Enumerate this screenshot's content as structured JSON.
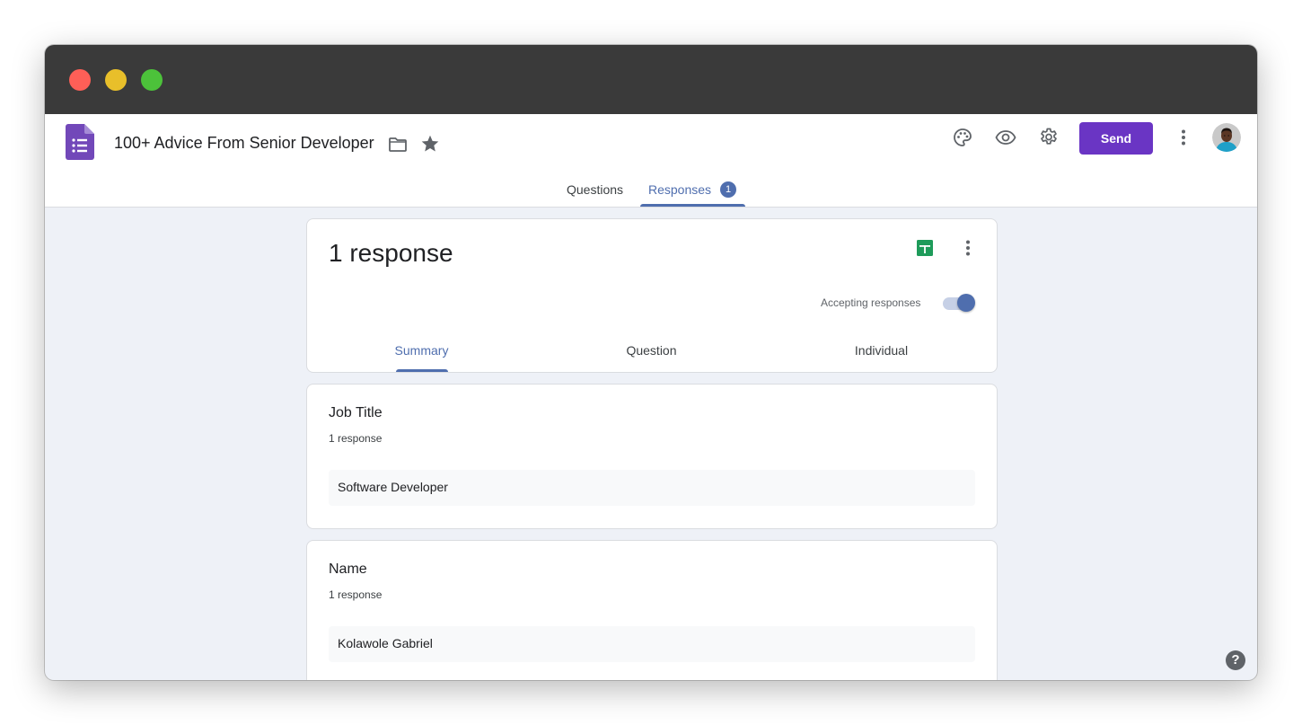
{
  "window": {
    "traffic_lights": [
      "close",
      "minimize",
      "zoom"
    ]
  },
  "header": {
    "doc_title": "100+ Advice From Senior Developer",
    "logo_icon": "google-forms-icon",
    "icons": [
      "folder-icon",
      "star-icon",
      "palette-icon",
      "eye-icon",
      "gear-icon",
      "more-vert-icon"
    ],
    "send_label": "Send",
    "accent_color": "#6a35c4"
  },
  "tabs": {
    "questions_label": "Questions",
    "responses_label": "Responses",
    "responses_badge": "1",
    "active": "Responses"
  },
  "summary": {
    "response_count": "1 response",
    "accepting_label": "Accepting responses",
    "accepting_on": true,
    "subtabs": [
      "Summary",
      "Question",
      "Individual"
    ],
    "active_subtab": "Summary"
  },
  "questions": [
    {
      "title": "Job Title",
      "count": "1 response",
      "answer": "Software Developer"
    },
    {
      "title": "Name",
      "count": "1 response",
      "answer": "Kolawole Gabriel"
    }
  ],
  "help": {
    "symbol": "?"
  }
}
